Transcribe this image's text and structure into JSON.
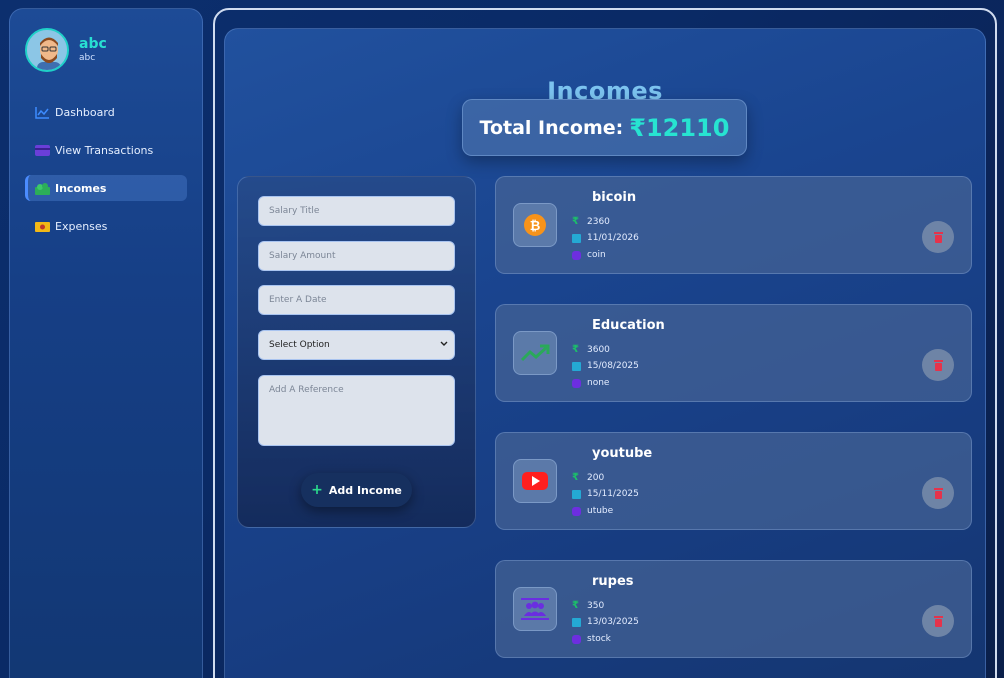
{
  "user": {
    "name": "abc",
    "subtitle": "abc"
  },
  "nav": [
    {
      "label": "Dashboard",
      "icon": "chart-line-icon",
      "active": false
    },
    {
      "label": "View Transactions",
      "icon": "credit-card-icon",
      "active": false
    },
    {
      "label": "Incomes",
      "icon": "money-stack-icon",
      "active": true
    },
    {
      "label": "Expenses",
      "icon": "cash-icon",
      "active": false
    }
  ],
  "page": {
    "title": "Incomes",
    "total_label": "Total Income:",
    "total_value": "₹12110"
  },
  "form": {
    "title_placeholder": "Salary Title",
    "amount_placeholder": "Salary Amount",
    "date_placeholder": "Enter A Date",
    "select_value": "Select Option",
    "reference_placeholder": "Add A Reference",
    "submit_label": "Add Income"
  },
  "incomes": [
    {
      "title": "bicoin",
      "amount": "2360",
      "date": "11/01/2026",
      "description": "coin",
      "icon": "bitcoin-icon"
    },
    {
      "title": "Education",
      "amount": "3600",
      "date": "15/08/2025",
      "description": "none",
      "icon": "trending-up-icon"
    },
    {
      "title": "youtube",
      "amount": "200",
      "date": "15/11/2025",
      "description": "utube",
      "icon": "youtube-icon"
    },
    {
      "title": "rupes",
      "amount": "350",
      "date": "13/03/2025",
      "description": "stock",
      "icon": "users-icon"
    }
  ],
  "colors": {
    "accent": "#27e3d1",
    "title": "#7cc3ef",
    "delete": "#e5334b",
    "rupee": "#1cbf6a"
  }
}
